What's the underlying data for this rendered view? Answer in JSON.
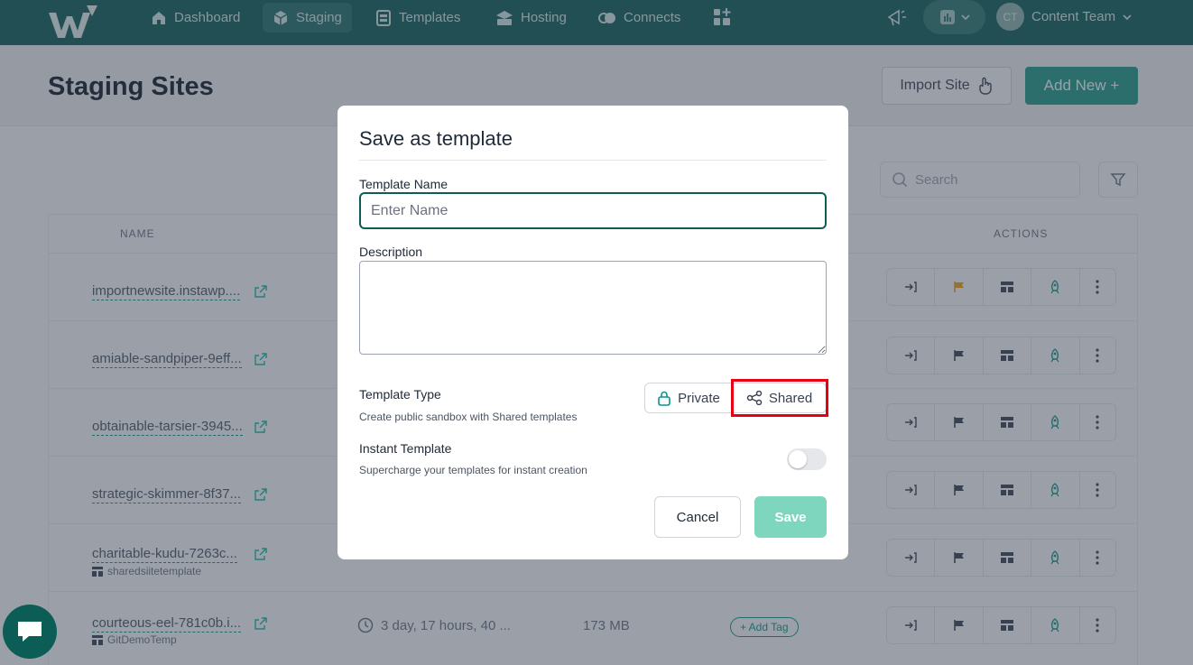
{
  "nav": {
    "items": [
      {
        "label": "Dashboard",
        "icon": "home-icon"
      },
      {
        "label": "Staging",
        "icon": "cube-icon"
      },
      {
        "label": "Templates",
        "icon": "template-icon"
      },
      {
        "label": "Hosting",
        "icon": "server-icon"
      },
      {
        "label": "Connects",
        "icon": "connect-icon"
      }
    ],
    "avatar_initials": "CT",
    "team_name": "Content Team"
  },
  "page": {
    "title": "Staging Sites",
    "import_label": "Import Site",
    "add_new_label": "Add New +",
    "search_placeholder": "Search"
  },
  "table": {
    "headers": {
      "name": "NAME",
      "actions": "ACTIONS"
    },
    "rows": [
      {
        "name": "importnewsite.instawp...."
      },
      {
        "name": "amiable-sandpiper-9eff..."
      },
      {
        "name": "obtainable-tarsier-3945..."
      },
      {
        "name": "strategic-skimmer-8f37..."
      },
      {
        "name": "charitable-kudu-7263c...",
        "template": "sharedsiitetemplate"
      },
      {
        "name": "courteous-eel-781c0b.i...",
        "template": "GitDemoTemp",
        "time": "3 day, 17 hours, 40 ...",
        "size": "173 MB",
        "tag": "+ Add Tag"
      }
    ]
  },
  "modal": {
    "title": "Save as template",
    "template_name_label": "Template Name",
    "template_name_placeholder": "Enter Name",
    "description_label": "Description",
    "template_type_label": "Template Type",
    "template_type_help": "Create public sandbox with Shared templates",
    "private_label": "Private",
    "shared_label": "Shared",
    "instant_label": "Instant Template",
    "instant_help": "Supercharge your templates for instant creation",
    "cancel_label": "Cancel",
    "save_label": "Save"
  },
  "colors": {
    "brand": "#0b5d56",
    "accent": "#1e9a86",
    "highlight": "#e60012"
  }
}
